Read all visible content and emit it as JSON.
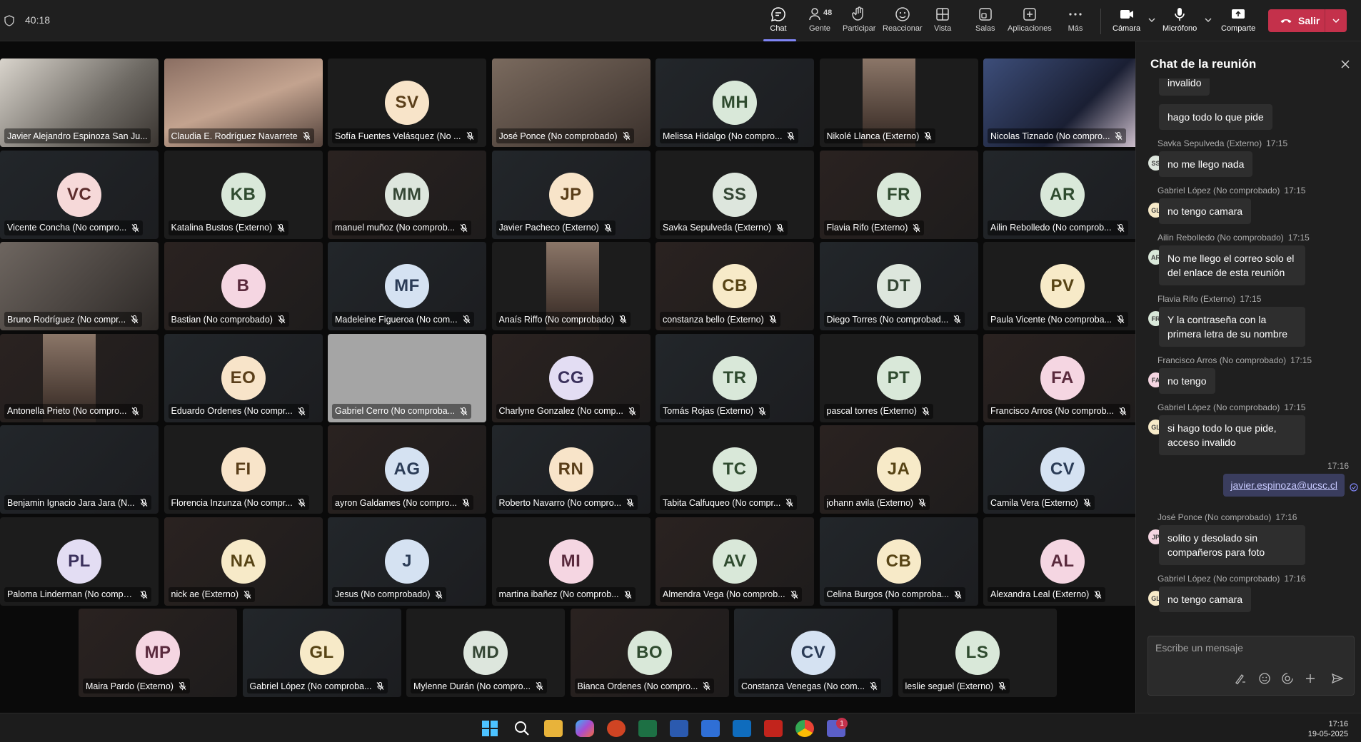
{
  "meeting": {
    "timer": "40:18"
  },
  "toolbar": {
    "chat": "Chat",
    "people": "Gente",
    "people_count": "48",
    "raise": "Participar",
    "react": "Reaccionar",
    "view": "Vista",
    "rooms": "Salas",
    "apps": "Aplicaciones",
    "more": "Más",
    "camera": "Cámara",
    "mic": "Micrófono",
    "share": "Comparte",
    "leave": "Salir"
  },
  "participants": [
    {
      "name": "Javier Alejandro Espinoza San Ju...",
      "initials": "",
      "video": true
    },
    {
      "name": "Claudia E. Rodríguez Navarrete",
      "initials": "",
      "video": true
    },
    {
      "name": "Sofía Fuentes Velásquez (No ...",
      "initials": "SV"
    },
    {
      "name": "José Ponce (No comprobado)",
      "initials": "",
      "video": true
    },
    {
      "name": "Melissa Hidalgo (No compro...",
      "initials": "MH"
    },
    {
      "name": "Nikolé Llanca (Externo)",
      "initials": "",
      "video": true
    },
    {
      "name": "Nicolas Tiznado (No compro...",
      "initials": "",
      "video": true
    },
    {
      "name": "Vicente Concha (No compro...",
      "initials": "VC"
    },
    {
      "name": "Katalina Bustos (Externo)",
      "initials": "KB"
    },
    {
      "name": "manuel muñoz (No comprob...",
      "initials": "MM"
    },
    {
      "name": "Javier Pacheco (Externo)",
      "initials": "JP"
    },
    {
      "name": "Savka Sepulveda (Externo)",
      "initials": "SS"
    },
    {
      "name": "Flavia Rifo (Externo)",
      "initials": "FR"
    },
    {
      "name": "Ailin Rebolledo (No comprob...",
      "initials": "AR"
    },
    {
      "name": "Bruno Rodríguez (No compr...",
      "initials": "",
      "video": true
    },
    {
      "name": "Bastian (No comprobado)",
      "initials": "B"
    },
    {
      "name": "Madeleine Figueroa (No com...",
      "initials": "MF"
    },
    {
      "name": "Anaís Riffo (No comprobado)",
      "initials": "",
      "video": true
    },
    {
      "name": "constanza bello (Externo)",
      "initials": "CB"
    },
    {
      "name": "Diego Torres (No comprobad...",
      "initials": "DT"
    },
    {
      "name": "Paula Vicente (No comproba...",
      "initials": "PV"
    },
    {
      "name": "Antonella Prieto (No compro...",
      "initials": "",
      "video": true
    },
    {
      "name": "Eduardo Ordenes (No compr...",
      "initials": "EO"
    },
    {
      "name": "Gabriel Cerro (No comproba...",
      "initials": ""
    },
    {
      "name": "Charlyne Gonzalez (No comp...",
      "initials": "CG"
    },
    {
      "name": "Tomás Rojas (Externo)",
      "initials": "TR"
    },
    {
      "name": "pascal torres (Externo)",
      "initials": "PT"
    },
    {
      "name": "Francisco Arros (No comprob...",
      "initials": "FA"
    },
    {
      "name": "Benjamin Ignacio Jara Jara (N...",
      "initials": ""
    },
    {
      "name": "Florencia Inzunza (No compr...",
      "initials": "FI"
    },
    {
      "name": "ayron Galdames (No compro...",
      "initials": "AG"
    },
    {
      "name": "Roberto Navarro (No compro...",
      "initials": "RN"
    },
    {
      "name": "Tabita Calfuqueo (No compr...",
      "initials": "TC"
    },
    {
      "name": "johann avila (Externo)",
      "initials": "JA"
    },
    {
      "name": "Camila Vera (Externo)",
      "initials": "CV"
    },
    {
      "name": "Paloma Linderman (No comproba...",
      "initials": "PL"
    },
    {
      "name": "nick ae (Externo)",
      "initials": "NA"
    },
    {
      "name": "Jesus (No comprobado)",
      "initials": "J"
    },
    {
      "name": "martina ibañez (No comprob...",
      "initials": "MI"
    },
    {
      "name": "Almendra Vega (No comprob...",
      "initials": "AV"
    },
    {
      "name": "Celina Burgos (No comproba...",
      "initials": "CB"
    },
    {
      "name": "Alexandra Leal (Externo)",
      "initials": "AL"
    },
    {
      "name": "Maira Pardo (Externo)",
      "initials": "MP"
    },
    {
      "name": "Gabriel López (No comproba...",
      "initials": "GL"
    },
    {
      "name": "Mylenne Durán (No compro...",
      "initials": "MD"
    },
    {
      "name": "Bianca Ordenes (No compro...",
      "initials": "BO"
    },
    {
      "name": "Constanza Venegas (No com...",
      "initials": "CV"
    },
    {
      "name": "leslie seguel (Externo)",
      "initials": "LS"
    }
  ],
  "chat": {
    "title": "Chat de la reunión",
    "messages": [
      {
        "sender": "",
        "time": "",
        "initials": "",
        "text": "invalido"
      },
      {
        "sender": "",
        "time": "",
        "initials": "",
        "text": "hago todo lo que pide"
      },
      {
        "sender": "Savka Sepulveda (Externo)",
        "time": "17:15",
        "initials": "SS",
        "text": "no me llego nada"
      },
      {
        "sender": "Gabriel López (No comprobado)",
        "time": "17:15",
        "initials": "GL",
        "text": "no tengo camara"
      },
      {
        "sender": "Ailin Rebolledo (No comprobado)",
        "time": "17:15",
        "initials": "AR",
        "text": "No me llego el correo solo el del enlace de esta reunión"
      },
      {
        "sender": "Flavia Rifo (Externo)",
        "time": "17:15",
        "initials": "FR",
        "text": "Y la contraseña con la primera letra de su nombre"
      },
      {
        "sender": "Francisco Arros (No comprobado)",
        "time": "17:15",
        "initials": "FA",
        "text": "no tengo"
      },
      {
        "sender": "Gabriel López (No comprobado)",
        "time": "17:15",
        "initials": "GL",
        "text": "si hago todo lo que pide, acceso invalido"
      },
      {
        "sender": "José Ponce (No comprobado)",
        "time": "17:16",
        "initials": "JP",
        "text": "solito y desolado sin compañeros para foto"
      },
      {
        "sender": "Gabriel López (No comprobado)",
        "time": "17:16",
        "initials": "GL",
        "text": "no tengo camara"
      }
    ],
    "own_message": {
      "time": "17:16",
      "text": "javier.espinoza@ucsc.cl"
    },
    "compose_placeholder": "Escribe un mensaje"
  },
  "taskbar": {
    "time": "17:16",
    "date": "19-05-2025",
    "teams_badge": "1"
  },
  "colors": {
    "leave": "#c4314b",
    "accent": "#7f85f5",
    "tile": "#242424"
  }
}
